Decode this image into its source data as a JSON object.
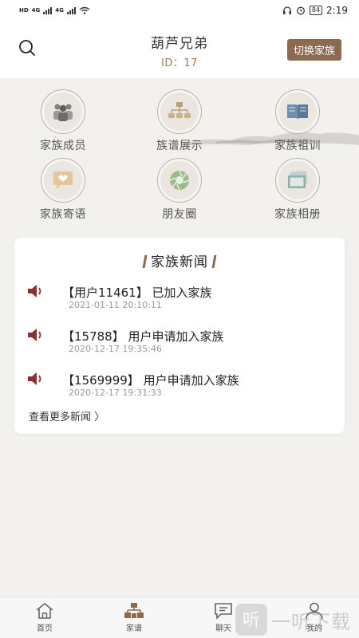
{
  "status_bar": {
    "left_indicators": [
      "HD",
      "4G",
      "4G"
    ],
    "battery": "84",
    "time": "2:19",
    "icons": [
      "headphones-icon",
      "alarm-icon",
      "battery-icon"
    ]
  },
  "header": {
    "title": "葫芦兄弟",
    "id_text": "ID：17",
    "switch_label": "切换家族",
    "search_icon": "search-icon"
  },
  "grid": [
    {
      "label": "家族成员",
      "icon": "people-icon"
    },
    {
      "label": "族谱展示",
      "icon": "tree-chart-icon"
    },
    {
      "label": "家族祖训",
      "icon": "book-icon"
    },
    {
      "label": "家族寄语",
      "icon": "heart-message-icon"
    },
    {
      "label": "朋友圈",
      "icon": "aperture-icon"
    },
    {
      "label": "家族相册",
      "icon": "album-icon"
    }
  ],
  "news": {
    "title": "家族新闻",
    "items": [
      {
        "text": "【用户11461】 已加入家族",
        "time": "2021-01-11 20:10:11"
      },
      {
        "text": "【15788】 用户申请加入家族",
        "time": "2020-12-17 19:35:46"
      },
      {
        "text": "【1569999】 用户申请加入家族",
        "time": "2020-12-17 19:31:33"
      }
    ],
    "more": "查看更多新闻 〉"
  },
  "bottom_nav": [
    {
      "label": "首页",
      "icon": "home-icon"
    },
    {
      "label": "家谱",
      "icon": "family-tree-icon"
    },
    {
      "label": "聊天",
      "icon": "chat-icon"
    },
    {
      "label": "我的",
      "icon": "user-icon"
    }
  ],
  "watermark": {
    "text": "一听下载",
    "logo": "听"
  },
  "colors": {
    "accent": "#8c6a4f",
    "id_color": "#a67c52",
    "background": "#f3f1ee",
    "speaker": "#8b2f2f"
  }
}
